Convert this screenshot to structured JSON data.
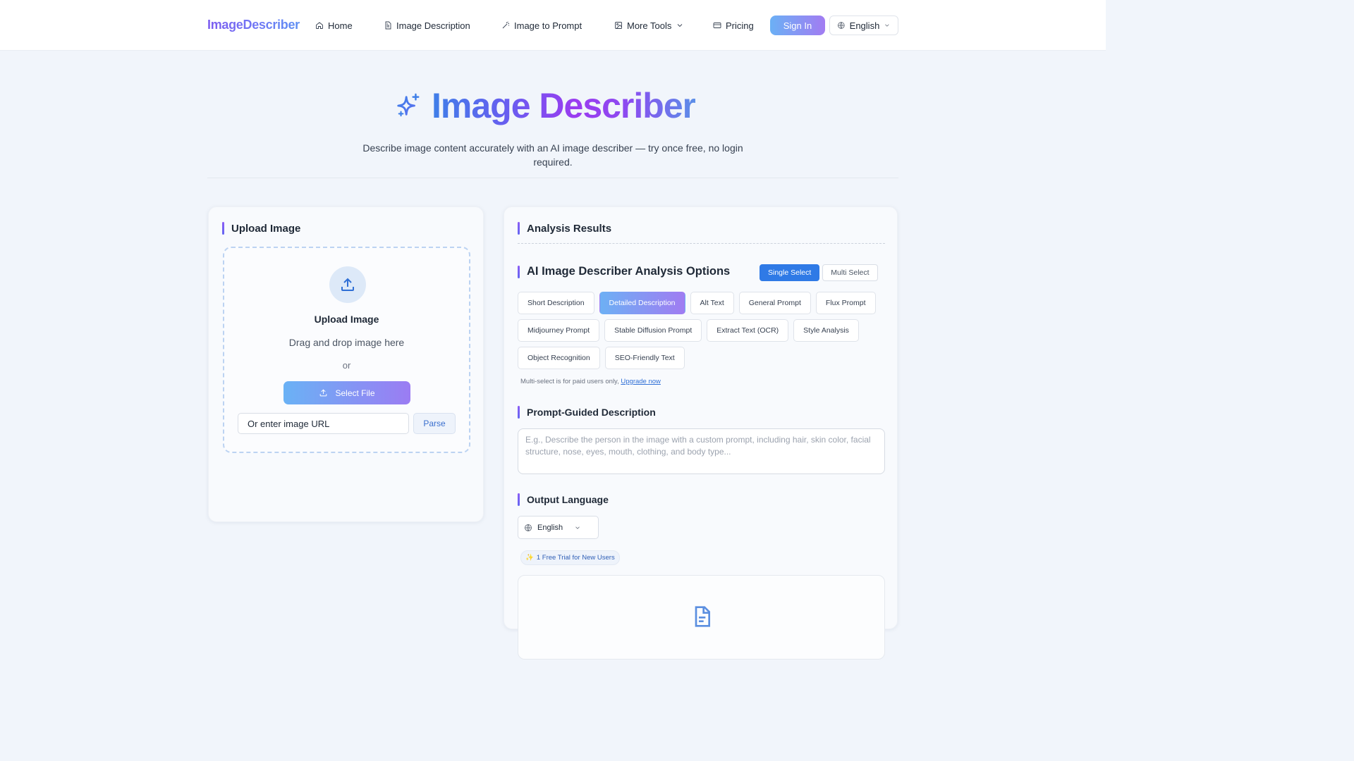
{
  "nav": {
    "logo": "ImageDescriber",
    "items": [
      {
        "label": "Home",
        "icon": "home-icon"
      },
      {
        "label": "Image Description",
        "icon": "document-icon"
      },
      {
        "label": "Image to Prompt",
        "icon": "magic-wand-icon"
      },
      {
        "label": "More Tools",
        "icon": "image-icon"
      },
      {
        "label": "Pricing",
        "icon": "card-icon"
      }
    ],
    "signin": "Sign In",
    "language": "English"
  },
  "hero": {
    "title": "Image Describer",
    "subtitle": "Describe image content accurately with an AI image describer — try once free, no login required."
  },
  "upload": {
    "heading": "Upload Image",
    "zone_title": "Upload Image",
    "drag_text": "Drag and drop image here",
    "or_text": "or",
    "select_file": "Select File",
    "url_placeholder": "Or enter image URL",
    "parse": "Parse"
  },
  "results": {
    "heading": "Analysis Results",
    "options_heading": "AI Image Describer Analysis Options",
    "toggle_single": "Single Select",
    "toggle_multi": "Multi Select",
    "options": [
      {
        "label": "Short Description",
        "selected": false
      },
      {
        "label": "Detailed Description",
        "selected": true
      },
      {
        "label": "Alt Text",
        "selected": false
      },
      {
        "label": "General Prompt",
        "selected": false
      },
      {
        "label": "Flux Prompt",
        "selected": false
      },
      {
        "label": "Midjourney Prompt",
        "selected": false
      },
      {
        "label": "Stable Diffusion Prompt",
        "selected": false
      },
      {
        "label": "Extract Text (OCR)",
        "selected": false
      },
      {
        "label": "Style Analysis",
        "selected": false
      },
      {
        "label": "Object Recognition",
        "selected": false
      },
      {
        "label": "SEO-Friendly Text",
        "selected": false
      }
    ],
    "multi_note": "Multi-select is for paid users only,",
    "upgrade_link": "Upgrade now",
    "prompt_heading": "Prompt-Guided Description",
    "prompt_placeholder": "E.g., Describe the person in the image with a custom prompt, including hair, skin color, facial structure, nose, eyes, mouth, clothing, and body type...",
    "output_heading": "Output Language",
    "output_language": "English",
    "trial_badge": "1 Free Trial for New Users"
  },
  "colors": {
    "accent_blue": "#2f7ae6",
    "accent_purple": "#8b5cf6",
    "page_bg": "#f1f5fb"
  }
}
